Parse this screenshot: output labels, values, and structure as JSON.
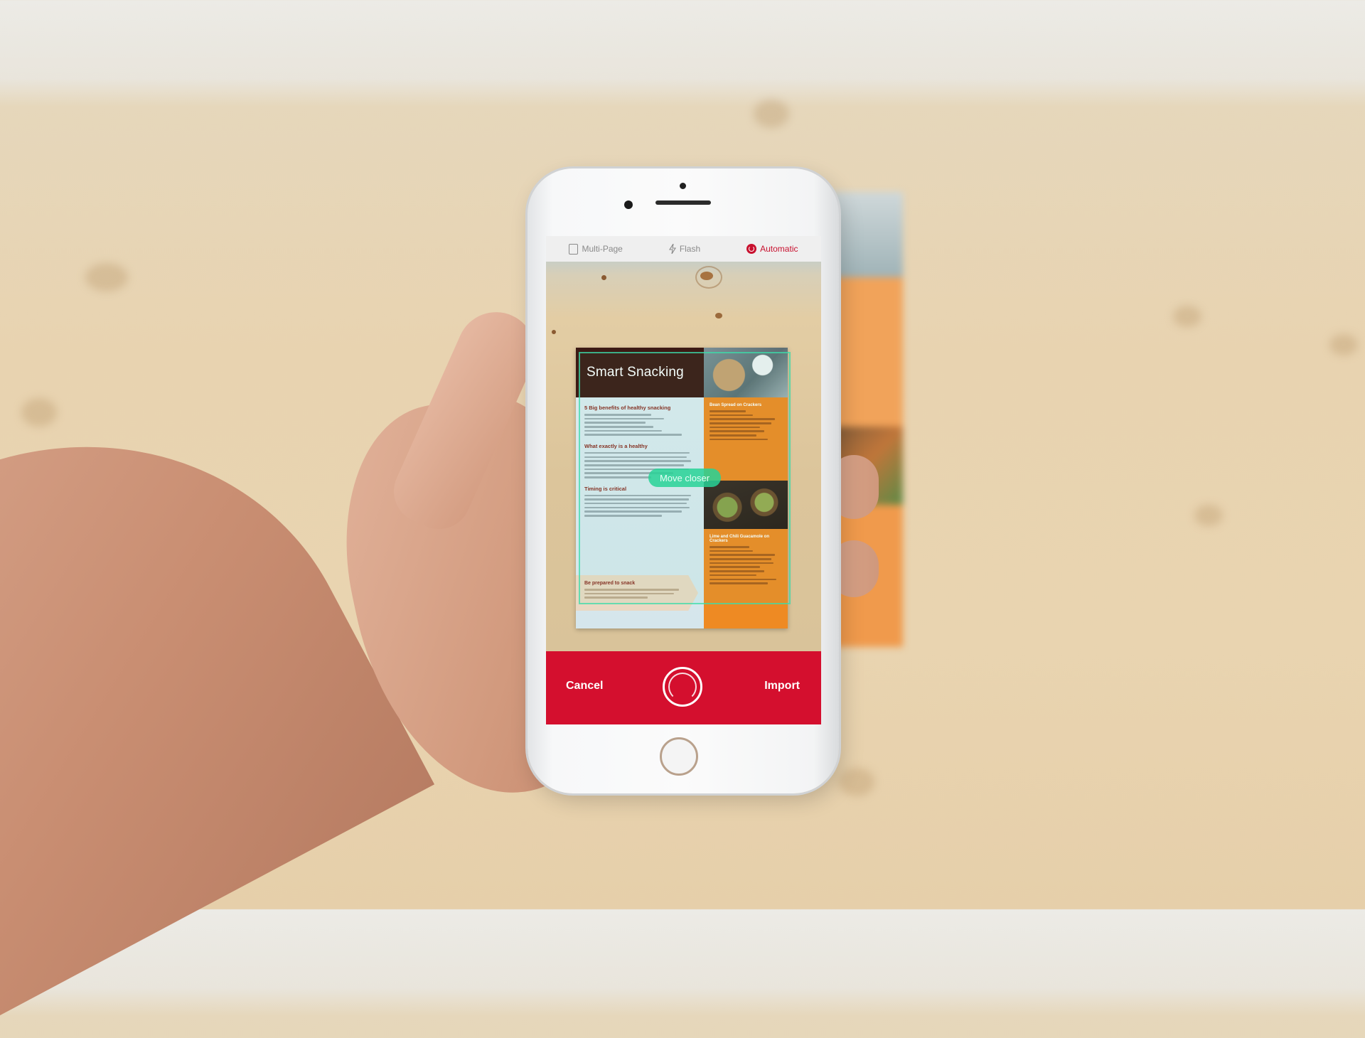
{
  "top_bar": {
    "multi_page_label": "Multi-Page",
    "flash_label": "Flash",
    "automatic_label": "Automatic"
  },
  "document": {
    "title": "Smart Snacking",
    "left_heading_1": "5 Big benefits of healthy snacking",
    "left_heading_2": "What exactly is a healthy",
    "left_heading_3": "Timing is critical",
    "tag_heading": "Be prepared to snack",
    "right_heading_1": "Bean Spread on Crackers",
    "right_heading_2": "Lime and Chili Guacamole on Crackers"
  },
  "scan_hint": "Move closer",
  "bottom_bar": {
    "cancel_label": "Cancel",
    "import_label": "Import"
  },
  "colors": {
    "accent": "#d40f2e",
    "detect": "#3cdca9"
  },
  "icons": {
    "multi_page": "multi-page-icon",
    "flash": "flash-icon",
    "automatic": "automatic-icon",
    "shutter": "shutter-button"
  }
}
